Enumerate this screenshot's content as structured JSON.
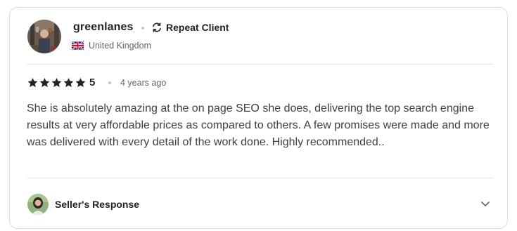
{
  "reviewer": {
    "username": "greenlanes",
    "badge_label": "Repeat Client",
    "badge_icon": "repeat-icon",
    "country": "United Kingdom",
    "country_flag": "uk-flag-icon"
  },
  "review": {
    "rating_value": "5",
    "stars_filled": 5,
    "stars_total": 5,
    "time_ago": "4 years ago",
    "text": "She is absolutely amazing at the on page SEO she does, delivering the top search engine results at very affordable prices as compared to others. A few promises were made and more was delivered with every detail of the work done. Highly recommended.."
  },
  "seller_response": {
    "label": "Seller's Response",
    "toggle_icon": "chevron-down-icon"
  },
  "colors": {
    "text_primary": "#222325",
    "text_body": "#404145",
    "text_muted": "#62646a",
    "border": "#dadbdd",
    "star": "#222325"
  }
}
